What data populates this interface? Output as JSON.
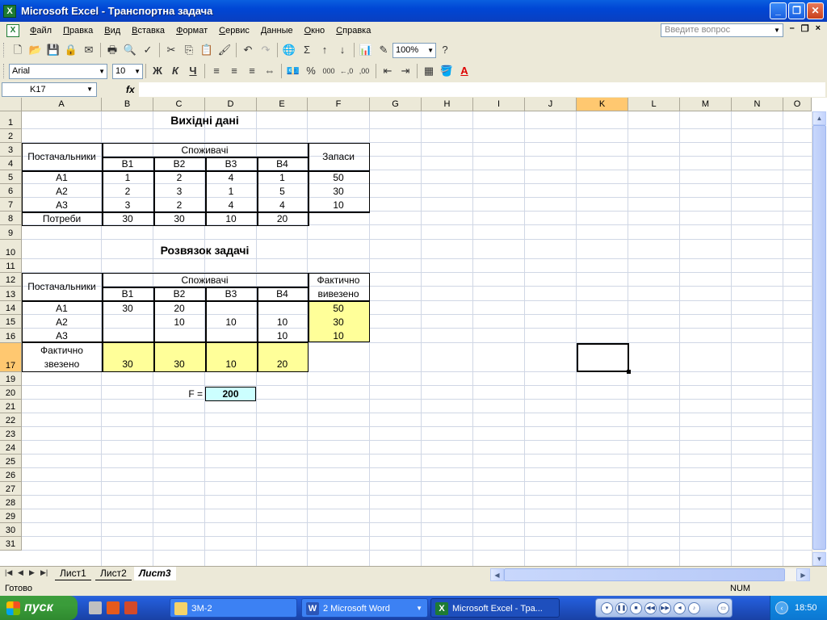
{
  "window": {
    "title": "Microsoft Excel - Транспортна задача",
    "app_icon": "X",
    "buttons": {
      "minimize": "_",
      "restore": "❐",
      "close": "✕"
    }
  },
  "menu": {
    "items": [
      "Файл",
      "Правка",
      "Вид",
      "Вставка",
      "Формат",
      "Сервис",
      "Данные",
      "Окно",
      "Справка"
    ],
    "help_placeholder": "Введите вопрос",
    "mdi": {
      "minimize": "–",
      "restore": "❐",
      "close": "×"
    }
  },
  "toolbar": {
    "zoom": "100%",
    "font": "Arial",
    "font_size": "10",
    "bold": "Ж",
    "italic": "К",
    "underline": "Ч",
    "percent": "%",
    "thousands": "000",
    "inc_decimal": "←,0",
    "dec_decimal": ",00",
    "font_color_label": "A",
    "sigma": "Σ",
    "help_q": "?"
  },
  "formula_bar": {
    "name_box": "K17",
    "fx": "fx",
    "value": ""
  },
  "grid": {
    "columns": [
      "A",
      "B",
      "C",
      "D",
      "E",
      "F",
      "G",
      "H",
      "I",
      "J",
      "K",
      "L",
      "M",
      "N",
      "O"
    ],
    "selected_column": "K",
    "rows": [
      "1",
      "2",
      "3",
      "4",
      "5",
      "6",
      "7",
      "8",
      "9",
      "10",
      "11",
      "12",
      "13",
      "14",
      "15",
      "16",
      "17",
      "19",
      "20",
      "21",
      "22",
      "23",
      "24",
      "25",
      "26",
      "27",
      "28",
      "29",
      "30",
      "31"
    ],
    "selected_cell": "K17"
  },
  "input_table": {
    "title": "Вихідні дані",
    "suppliers_label": "Постачальники",
    "consumers_label": "Споживачі",
    "stock_label": "Запаси",
    "consumers": [
      "B1",
      "B2",
      "B3",
      "B4"
    ],
    "rows": [
      {
        "supplier": "A1",
        "costs": [
          "1",
          "2",
          "4",
          "1"
        ],
        "stock": "50"
      },
      {
        "supplier": "A2",
        "costs": [
          "2",
          "3",
          "1",
          "5"
        ],
        "stock": "30"
      },
      {
        "supplier": "A3",
        "costs": [
          "3",
          "2",
          "4",
          "4"
        ],
        "stock": "10"
      }
    ],
    "demand_label": "Потреби",
    "demand": [
      "30",
      "30",
      "10",
      "20"
    ]
  },
  "solution_table": {
    "title": "Розвязок задачі",
    "suppliers_label": "Постачальники",
    "consumers_label": "Споживачі",
    "shipped_label_1": "Фактично",
    "shipped_label_2": "вивезено",
    "consumers": [
      "B1",
      "B2",
      "B3",
      "B4"
    ],
    "rows": [
      {
        "supplier": "A1",
        "values": [
          "30",
          "20",
          "",
          ""
        ],
        "shipped": "50"
      },
      {
        "supplier": "A2",
        "values": [
          "",
          "10",
          "10",
          "10"
        ],
        "shipped": "30"
      },
      {
        "supplier": "A3",
        "values": [
          "",
          "",
          "",
          "10"
        ],
        "shipped": "10"
      }
    ],
    "received_label_1": "Фактично",
    "received_label_2": "звезено",
    "received": [
      "30",
      "30",
      "10",
      "20"
    ],
    "objective_label": "F =",
    "objective_value": "200"
  },
  "sheet_tabs": {
    "tabs": [
      "Лист1",
      "Лист2",
      "Лист3"
    ],
    "active": "Лист3"
  },
  "status": {
    "text": "Готово",
    "num": "NUM"
  },
  "taskbar": {
    "start_label": "пуск",
    "tasks": [
      {
        "label": "ЗМ-2"
      },
      {
        "label": "2 Microsoft Word"
      },
      {
        "label": "Microsoft Excel - Тра..."
      }
    ],
    "clock": "18:50"
  },
  "colors": {
    "yellow_fill": "#ffff99",
    "cyan_fill": "#ccffff",
    "selection_header": "#ffc870"
  }
}
